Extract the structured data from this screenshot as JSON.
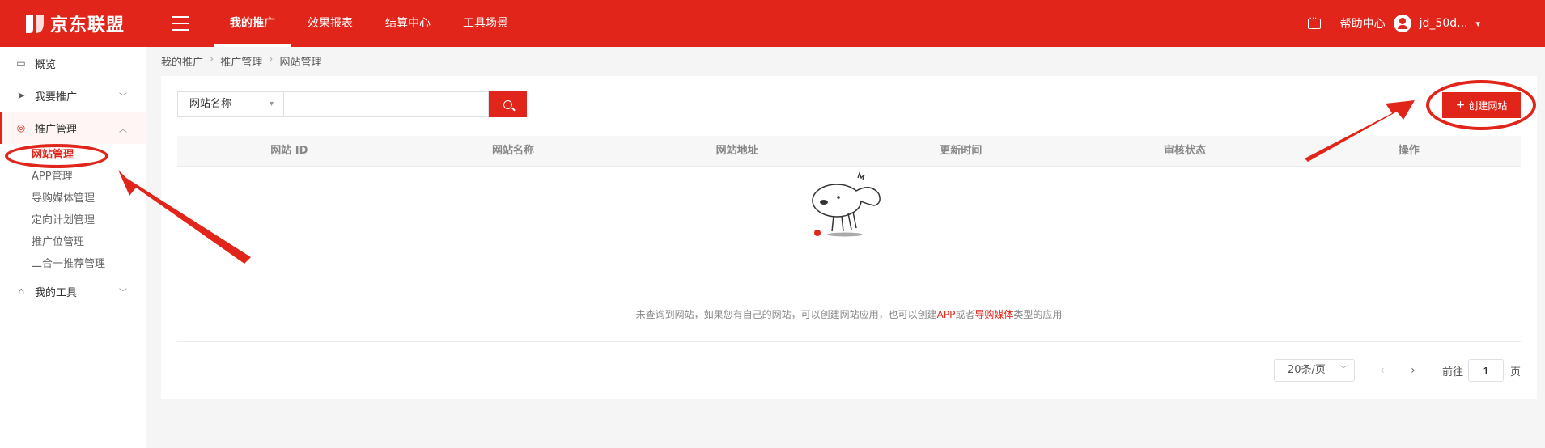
{
  "header": {
    "logo_text": "京东联盟",
    "nav": [
      {
        "label": "我的推广"
      },
      {
        "label": "效果报表"
      },
      {
        "label": "结算中心"
      },
      {
        "label": "工具场景"
      }
    ],
    "help": "帮助中心",
    "username": "jd_50d..."
  },
  "sidebar": {
    "items": [
      {
        "label": "概览"
      },
      {
        "label": "我要推广"
      },
      {
        "label": "推广管理"
      },
      {
        "label": "我的工具"
      }
    ],
    "sub_items": [
      {
        "label": "网站管理"
      },
      {
        "label": "APP管理"
      },
      {
        "label": "导购媒体管理"
      },
      {
        "label": "定向计划管理"
      },
      {
        "label": "推广位管理"
      },
      {
        "label": "二合一推荐管理"
      }
    ]
  },
  "breadcrumb": [
    "我的推广",
    "推广管理",
    "网站管理"
  ],
  "search": {
    "select_value": "网站名称",
    "placeholder": ""
  },
  "create_button": "创建网站",
  "table": {
    "columns": [
      "网站 ID",
      "网站名称",
      "网站地址",
      "更新时间",
      "审核状态",
      "操作"
    ]
  },
  "empty": {
    "text_before": "未查询到网站，如果您有自己的网站，可以创建网站应用，也可以创建",
    "link_app": "APP",
    "text_mid": "或者",
    "link_media": "导购媒体",
    "text_after": "类型的应用"
  },
  "pagination": {
    "page_size": "20条/页",
    "goto_label": "前往",
    "current_page": "1",
    "page_unit": "页"
  },
  "colors": {
    "brand": "#e1251b"
  }
}
